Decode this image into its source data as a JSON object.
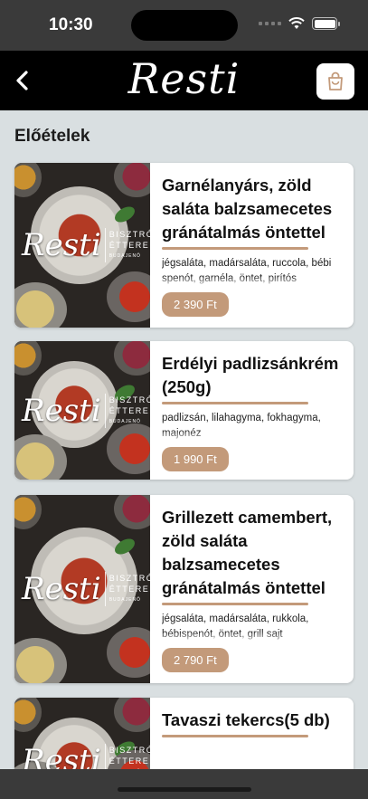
{
  "status": {
    "time": "10:30"
  },
  "header": {
    "logo": "Resti",
    "back_icon": "chevron-left-icon",
    "cart_icon": "shopping-bag-icon"
  },
  "section": {
    "title": "Előételek"
  },
  "image_brand": {
    "script": "Resti",
    "line1": "BISZTRÓ",
    "line2": "ÉTTEREM",
    "line3": "BUDAJENŐ"
  },
  "items": [
    {
      "name": "Garnélanyárs, zöld saláta balzsamecetes gránátalmás öntettel",
      "desc": "jégsaláta, madársaláta, ruccola, bébi spenót, garnéla, öntet, pirítós",
      "price": "2 390 Ft"
    },
    {
      "name": "Erdélyi padlizsánkrém (250g)",
      "desc": "padlizsán, lilahagyma, fokhagyma, majonéz",
      "price": "1 990 Ft"
    },
    {
      "name": "Grillezett camembert, zöld saláta balzsamecetes gránátalmás öntettel",
      "desc": "jégsaláta, madársaláta, rukkola, bébispenót, öntet, grill sajt",
      "price": "2 790 Ft"
    },
    {
      "name": "Tavaszi tekercs(5 db)",
      "desc": "",
      "price": ""
    }
  ],
  "colors": {
    "accent": "#c39a7a",
    "header": "#000000",
    "background": "#d9dfe1"
  }
}
